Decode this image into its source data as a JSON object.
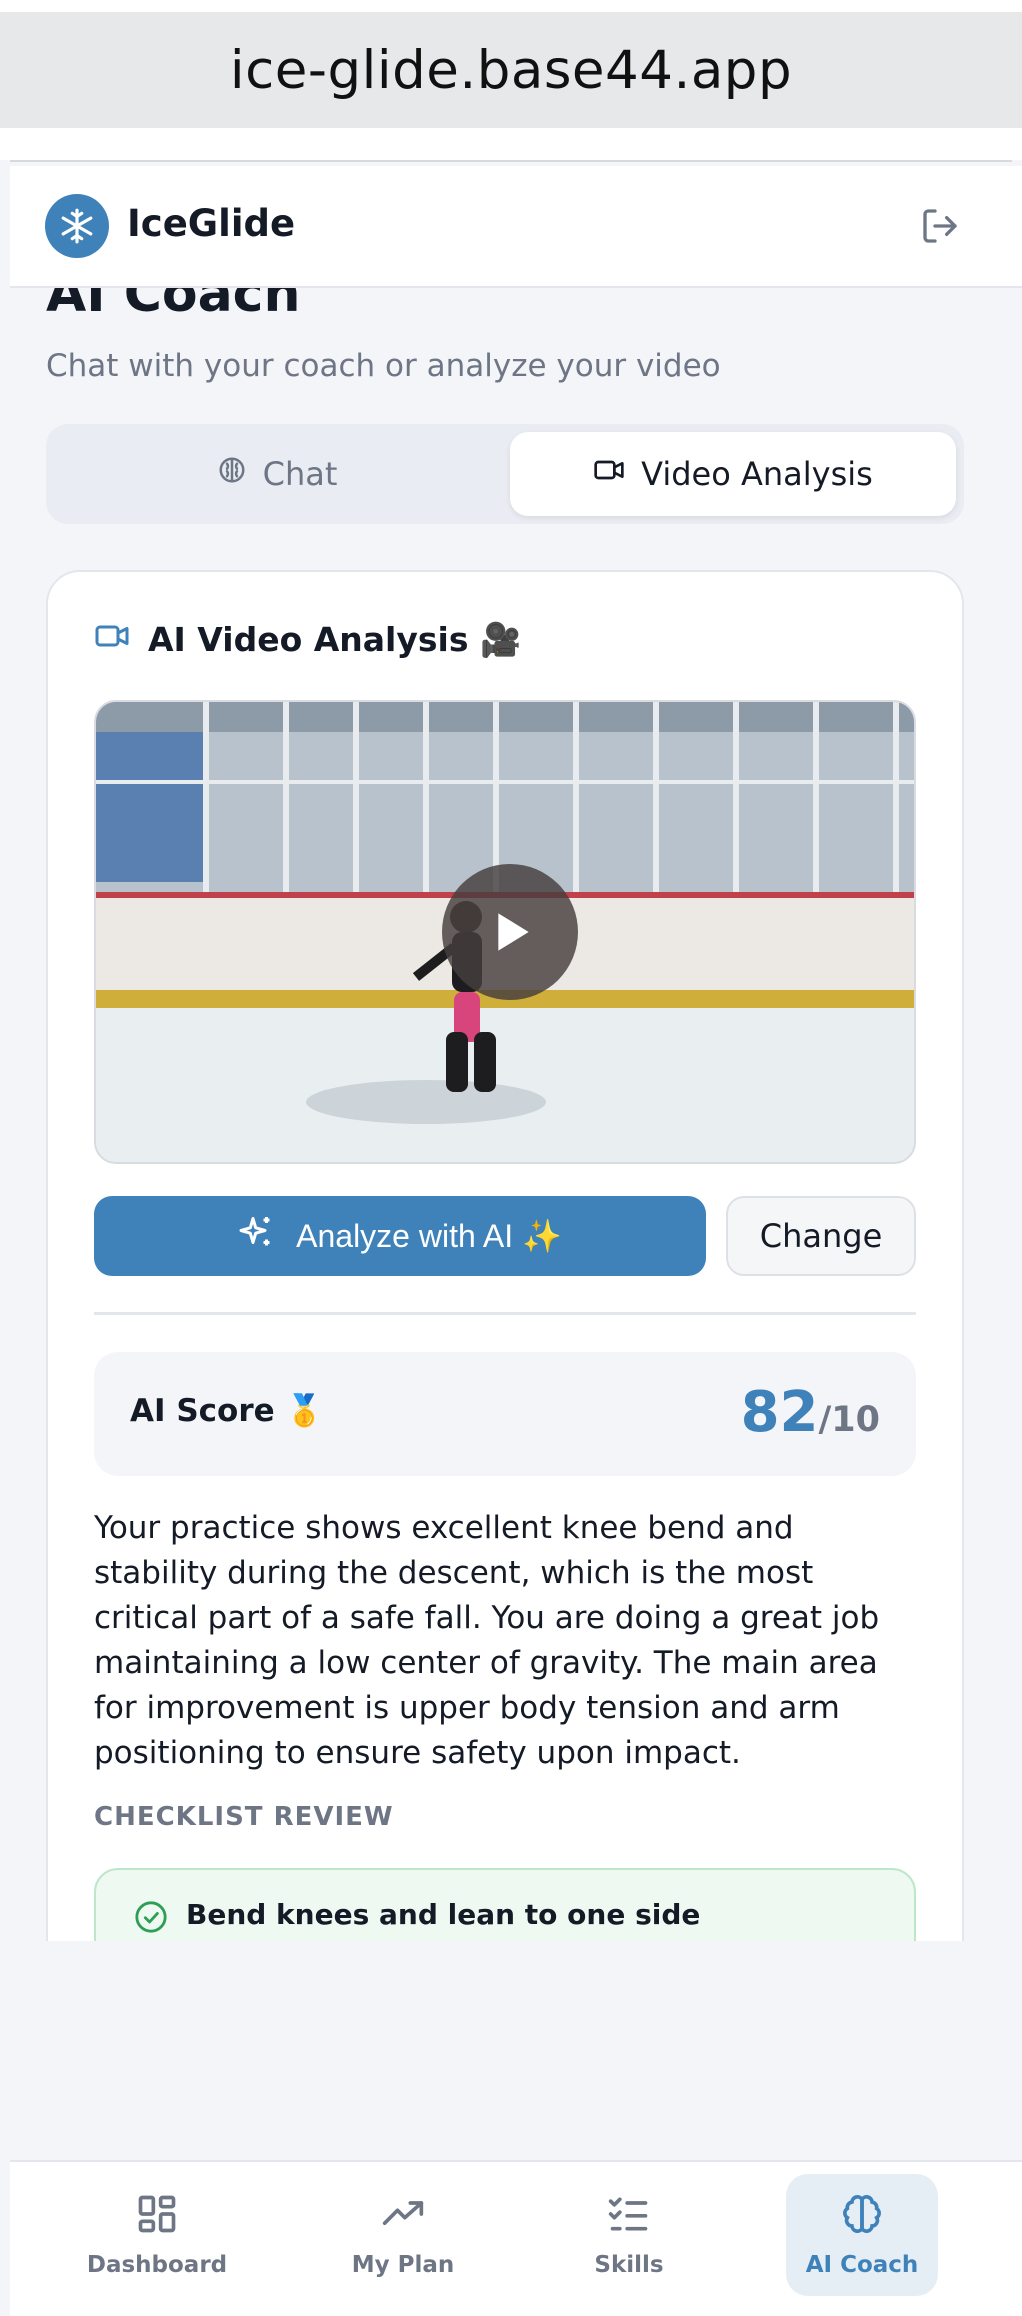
{
  "browser": {
    "url": "ice-glide.base44.app"
  },
  "header": {
    "brand": "IceGlide",
    "logo_icon": "snowflake-icon",
    "logout_icon": "logout-icon"
  },
  "page": {
    "title": "AI Coach",
    "subtitle": "Chat with your coach or analyze your video"
  },
  "tabs": [
    {
      "label": "Chat",
      "icon": "brain-icon",
      "active": false
    },
    {
      "label": "Video Analysis",
      "icon": "video-icon",
      "active": true
    }
  ],
  "analysis_card": {
    "title": "AI Video Analysis 🎥",
    "analyze_button": "Analyze with AI ✨",
    "change_button": "Change",
    "score_label": "AI Score 🥇",
    "score_value": "82",
    "score_max": "/10",
    "feedback": "Your practice shows excellent knee bend and stability during the descent, which is the most critical part of a safe fall. You are doing a great job maintaining a low center of gravity. The main area for improvement is upper body tension and arm positioning to ensure safety upon impact.",
    "checklist_label": "CHECKLIST REVIEW",
    "checklist": [
      {
        "text": "Bend knees and lean to one side",
        "status": "done"
      }
    ]
  },
  "bottom_nav": [
    {
      "label": "Dashboard",
      "icon": "grid-icon",
      "active": false
    },
    {
      "label": "My Plan",
      "icon": "trending-up-icon",
      "active": false
    },
    {
      "label": "Skills",
      "icon": "checklist-icon",
      "active": false
    },
    {
      "label": "AI Coach",
      "icon": "brain-icon",
      "active": true
    }
  ],
  "colors": {
    "accent": "#3f82ba",
    "success": "#2f9e55",
    "background": "#f3f5f9"
  }
}
